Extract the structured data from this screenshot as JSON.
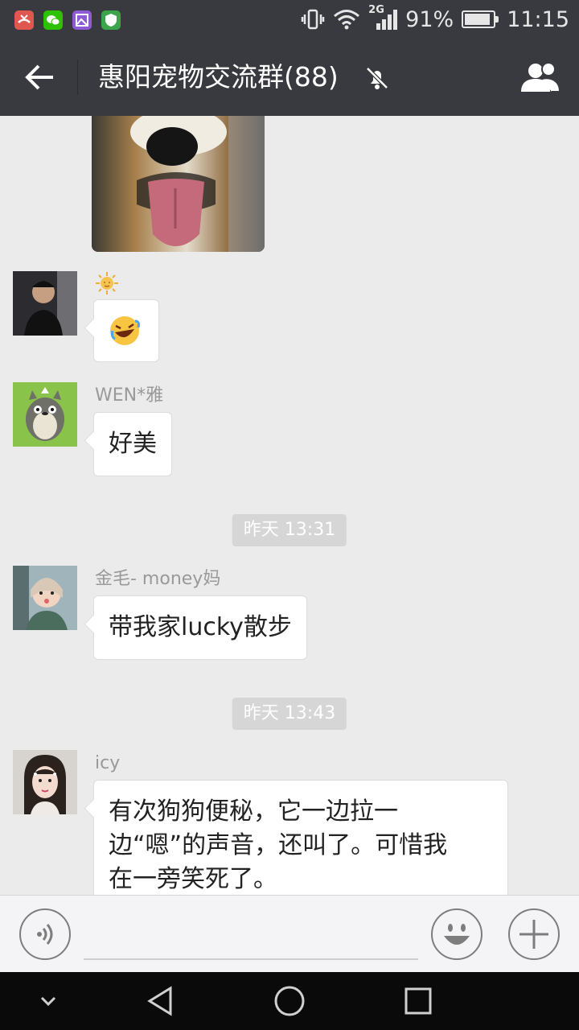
{
  "status_bar": {
    "battery": "91%",
    "battery_level": 0.91,
    "time": "11:15",
    "network": "2G",
    "icons": [
      "missed-call-icon",
      "wechat-icon",
      "gallery-icon",
      "shield-icon",
      "vibrate-icon",
      "wifi-icon",
      "signal-icon",
      "battery-icon"
    ]
  },
  "header": {
    "title": "惠阳宠物交流群(88)",
    "back_icon": "arrow-left-icon",
    "mute_icon": "bell-muted-icon",
    "members_icon": "group-members-icon"
  },
  "messages": [
    {
      "type": "image",
      "content": "dog-photo"
    },
    {
      "sender": "",
      "sender_emoji": "sun-emoji",
      "type": "emoji",
      "content": "rofl-emoji"
    },
    {
      "sender": "WEN*雅",
      "type": "text",
      "content": "好美"
    },
    {
      "type": "time",
      "content": "昨天 13:31"
    },
    {
      "sender": "金毛- money妈",
      "type": "text",
      "content": "带我家lucky散步"
    },
    {
      "type": "time",
      "content": "昨天 13:43"
    },
    {
      "sender": "icy",
      "type": "text",
      "lines": [
        "有次狗狗便秘，它一边拉一",
        "边“嗯”的声音，还叫了。可惜我",
        "在一旁笑死了。"
      ]
    }
  ],
  "input_bar": {
    "voice_icon": "voice-icon",
    "emoji_icon": "smiley-icon",
    "plus_icon": "plus-icon"
  },
  "nav_bar": {
    "icons": [
      "chevron-down-icon",
      "back-triangle-icon",
      "home-circle-icon",
      "recents-square-icon"
    ]
  },
  "colors": {
    "header_bg": "#393a3f",
    "chat_bg": "#ebebeb",
    "bubble_bg": "#ffffff",
    "time_badge": "#d6d6d6",
    "sender_text": "#999999"
  }
}
